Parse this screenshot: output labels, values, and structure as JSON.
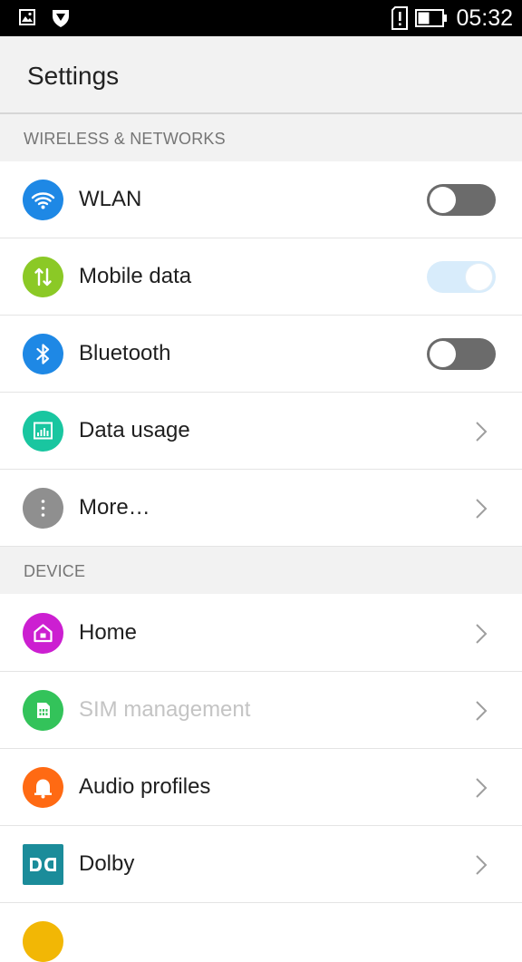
{
  "status_bar": {
    "time": "05:32",
    "left_icons": [
      "image-icon",
      "shield-icon"
    ],
    "right_icons": [
      "sim-alert-icon",
      "battery-icon"
    ],
    "battery_level": 0.45
  },
  "app_bar": {
    "title": "Settings"
  },
  "sections": [
    {
      "header": "WIRELESS & NETWORKS",
      "items": [
        {
          "label": "WLAN",
          "icon": "wifi-icon",
          "color": "#1e88e5",
          "control": "toggle",
          "on": false
        },
        {
          "label": "Mobile data",
          "icon": "mobile-data-icon",
          "color": "#8bc926",
          "control": "toggle",
          "on": true
        },
        {
          "label": "Bluetooth",
          "icon": "bluetooth-icon",
          "color": "#1e88e5",
          "control": "toggle",
          "on": false
        },
        {
          "label": "Data usage",
          "icon": "data-usage-icon",
          "color": "#19c6a0",
          "control": "chevron"
        },
        {
          "label": "More…",
          "icon": "more-icon",
          "color": "#8f8f8f",
          "control": "chevron"
        }
      ]
    },
    {
      "header": "DEVICE",
      "items": [
        {
          "label": "Home",
          "icon": "home-icon",
          "color": "#cc1fd1",
          "control": "chevron"
        },
        {
          "label": "SIM management",
          "icon": "sim-icon",
          "color": "#33c35a",
          "control": "chevron",
          "disabled": true
        },
        {
          "label": "Audio profiles",
          "icon": "bell-icon",
          "color": "#ff6a13",
          "control": "chevron"
        },
        {
          "label": "Dolby",
          "icon": "dolby-icon",
          "color": "#1b8c9a",
          "control": "chevron"
        }
      ]
    }
  ],
  "colors": {
    "status_bar": "#000000",
    "app_bar": "#f2f2f2",
    "toggle_off": "#6b6b6b",
    "toggle_on": "#d8ecfb",
    "next_item_icon": "#f2b705"
  }
}
